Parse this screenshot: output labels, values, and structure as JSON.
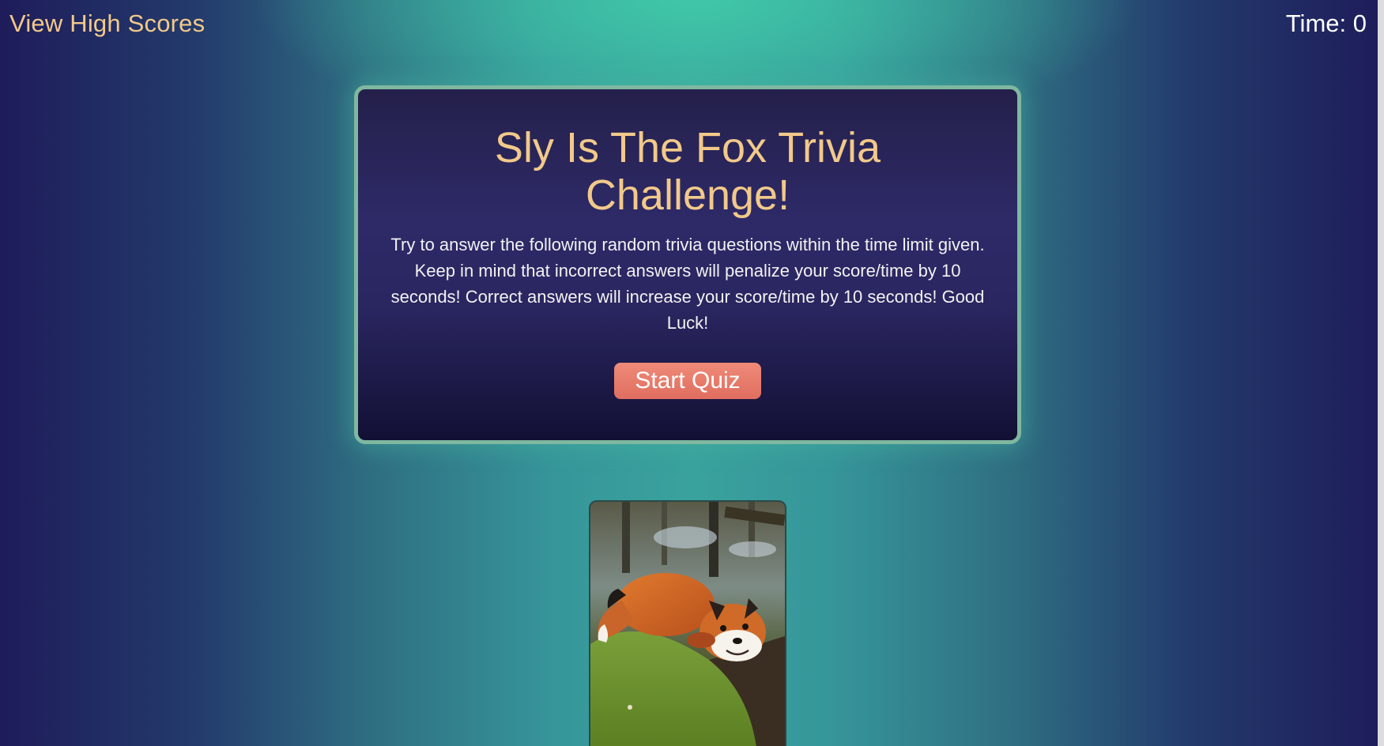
{
  "header": {
    "high_scores_label": "View High Scores",
    "timer_label": "Time:",
    "timer_value": "0"
  },
  "quiz": {
    "title": "Sly Is The Fox Trivia Challenge!",
    "description": "Try to answer the following random trivia questions within the time limit given. Keep in mind that incorrect answers will penalize your score/time by 10 seconds! Correct answers will increase your score/time by 10 seconds! Good Luck!",
    "start_button_label": "Start Quiz"
  },
  "image": {
    "subject": "red fox lying on mossy log",
    "icon": "fox-photo"
  },
  "colors": {
    "accent_text": "#f2c98a",
    "button": "#e87a6a",
    "card_border": "#7fb8a0",
    "teal": "#3aa29d",
    "navy": "#1e1c5a"
  }
}
